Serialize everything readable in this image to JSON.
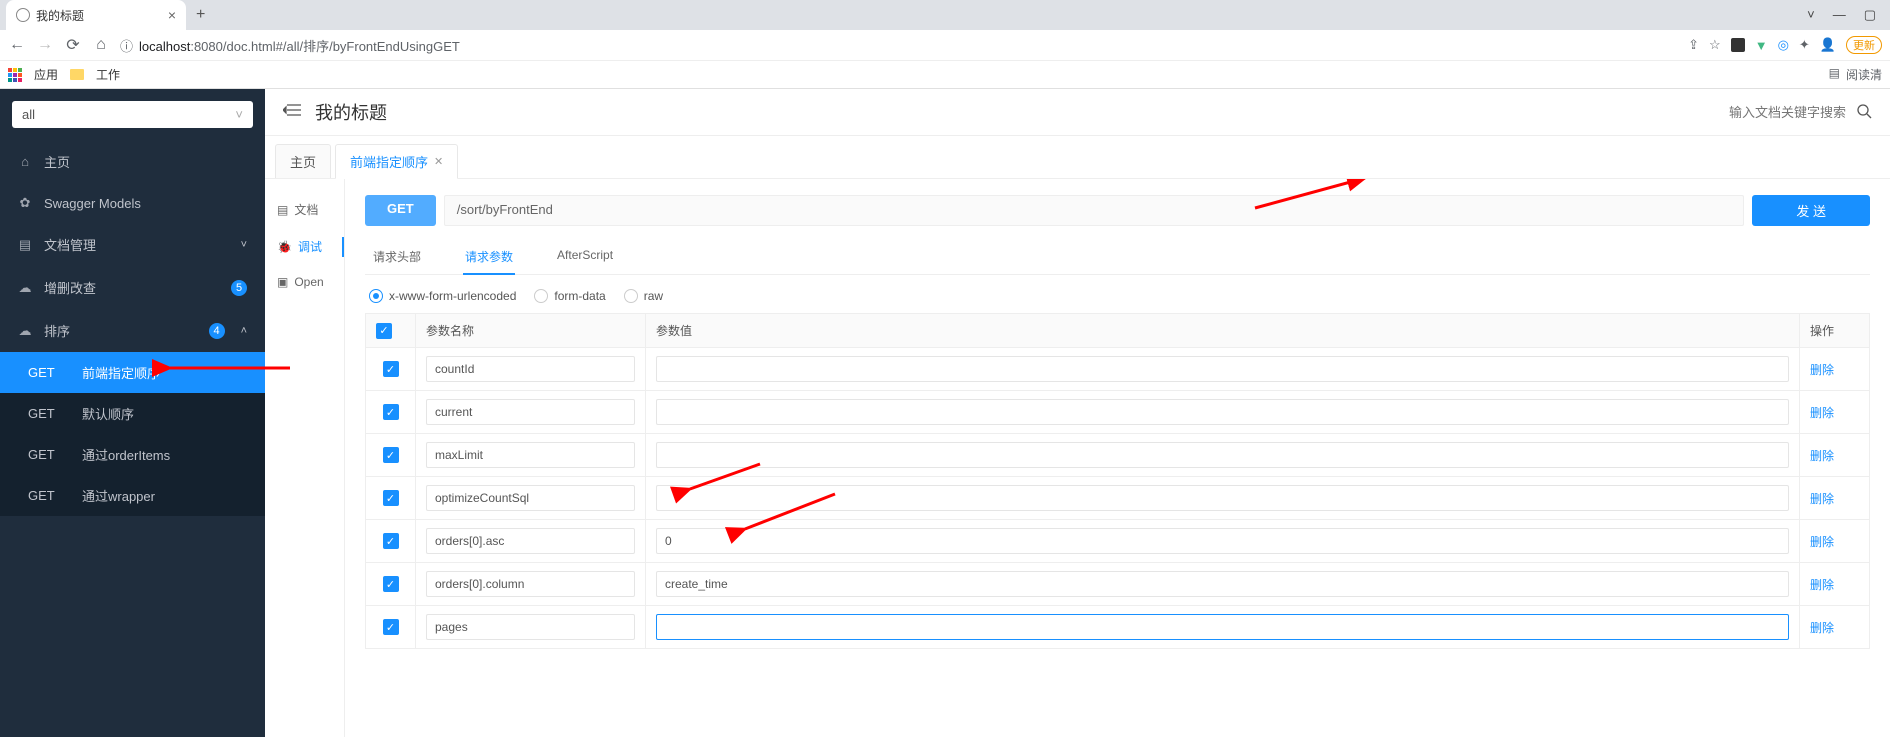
{
  "browser": {
    "tab_title": "我的标题",
    "url_info_icon": "ⓘ",
    "url_host": "localhost",
    "url_port": ":8080",
    "url_path": "/doc.html#/all/排序/byFrontEndUsingGET",
    "update_label": "更新",
    "bookmark_apps": "应用",
    "bookmark_work": "工作",
    "reading_list": "阅读清"
  },
  "sidebar": {
    "select_value": "all",
    "home": "主页",
    "swagger": "Swagger Models",
    "doc_mgmt": "文档管理",
    "crud": "增删改查",
    "crud_badge": "5",
    "sort": "排序",
    "sort_badge": "4",
    "sub": [
      {
        "method": "GET",
        "label": "前端指定顺序"
      },
      {
        "method": "GET",
        "label": "默认顺序"
      },
      {
        "method": "GET",
        "label": "通过orderItems"
      },
      {
        "method": "GET",
        "label": "通过wrapper"
      }
    ]
  },
  "header": {
    "title": "我的标题",
    "search_placeholder": "输入文档关键字搜索"
  },
  "tabs": {
    "home": "主页",
    "current": "前端指定顺序"
  },
  "inner": {
    "doc": "文档",
    "debug": "调试",
    "open": "Open"
  },
  "request": {
    "method": "GET",
    "path": "/sort/byFrontEnd",
    "send": "发 送"
  },
  "subtabs": {
    "headers": "请求头部",
    "params": "请求参数",
    "after": "AfterScript"
  },
  "bodytypes": {
    "urlencoded": "x-www-form-urlencoded",
    "formdata": "form-data",
    "raw": "raw"
  },
  "table": {
    "col_name": "参数名称",
    "col_value": "参数值",
    "col_op": "操作",
    "delete": "删除",
    "rows": [
      {
        "name": "countId",
        "value": ""
      },
      {
        "name": "current",
        "value": ""
      },
      {
        "name": "maxLimit",
        "value": ""
      },
      {
        "name": "optimizeCountSql",
        "value": ""
      },
      {
        "name": "orders[0].asc",
        "value": "0"
      },
      {
        "name": "orders[0].column",
        "value": "create_time"
      },
      {
        "name": "pages",
        "value": ""
      }
    ]
  }
}
